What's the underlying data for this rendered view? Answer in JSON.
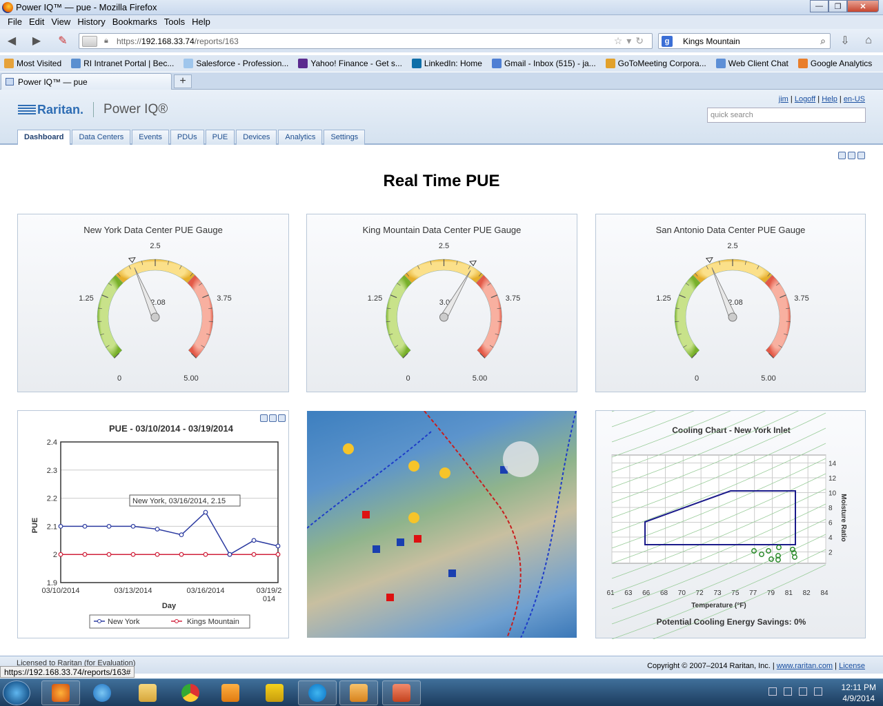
{
  "window": {
    "title": "Power IQ™ — pue - Mozilla Firefox"
  },
  "menu": [
    "File",
    "Edit",
    "View",
    "History",
    "Bookmarks",
    "Tools",
    "Help"
  ],
  "nav": {
    "url_prefix": "https://",
    "url_host": "192.168.33.74",
    "url_path": "/reports/163",
    "search_value": "Kings Mountain"
  },
  "bookmarks": [
    {
      "label": "Most Visited",
      "color": "#e6a23a"
    },
    {
      "label": "RI Intranet Portal | Bec...",
      "color": "#5a8fd0"
    },
    {
      "label": "Salesforce - Profession...",
      "color": "#9fc6ec"
    },
    {
      "label": "Yahoo! Finance - Get s...",
      "color": "#5b2b8f"
    },
    {
      "label": "LinkedIn: Home",
      "color": "#0e6ea8"
    },
    {
      "label": "Gmail - Inbox (515) - ja...",
      "color": "#4e7fd4"
    },
    {
      "label": "GoToMeeting Corpora...",
      "color": "#e2a12b"
    },
    {
      "label": "Web Client Chat",
      "color": "#5d8fd6"
    },
    {
      "label": "Google Analytics",
      "color": "#e97e2b"
    }
  ],
  "tab": {
    "label": "Power IQ™ — pue",
    "new": "+"
  },
  "app": {
    "brand": "Raritan.",
    "product": "Power IQ®",
    "user": "jim",
    "logoff": "Logoff",
    "help": "Help",
    "locale": "en-US",
    "quick_search_placeholder": "quick search",
    "tabs": [
      "Dashboard",
      "Data Centers",
      "Events",
      "PDUs",
      "PUE",
      "Devices",
      "Analytics",
      "Settings"
    ]
  },
  "page": {
    "title": "Real Time PUE"
  },
  "gauges": [
    {
      "title": "New York Data Center PUE Gauge",
      "value_label": "2.08",
      "value": 2.08,
      "min_label": "0",
      "max_label": "5.00",
      "t1": "1.25",
      "t2": "2.5",
      "t3": "3.75"
    },
    {
      "title": "King Mountain Data Center PUE Gauge",
      "value_label": "3.05",
      "value": 3.05,
      "min_label": "0",
      "max_label": "5.00",
      "t1": "1.25",
      "t2": "2.5",
      "t3": "3.75"
    },
    {
      "title": "San Antonio Data Center PUE Gauge",
      "value_label": "2.08",
      "value": 2.08,
      "min_label": "0",
      "max_label": "5.00",
      "t1": "1.25",
      "t2": "2.5",
      "t3": "3.75"
    }
  ],
  "chart_data": {
    "type": "line",
    "title": "PUE - 03/10/2014 - 03/19/2014",
    "xlabel": "Day",
    "ylabel": "PUE",
    "ylim": [
      1.9,
      2.4
    ],
    "yticks": [
      "1.9",
      "2",
      "2.1",
      "2.2",
      "2.3",
      "2.4"
    ],
    "xtick_labels": [
      "03/10/2014",
      "03/13/2014",
      "03/16/2014",
      "03/19/2",
      "014"
    ],
    "x": [
      0,
      1,
      2,
      3,
      4,
      5,
      6,
      7,
      8,
      9
    ],
    "series": [
      {
        "name": "New York",
        "values": [
          2.1,
          2.1,
          2.1,
          2.1,
          2.09,
          2.07,
          2.15,
          2.0,
          2.05,
          2.03
        ],
        "color": "#2b3aa0"
      },
      {
        "name": "Kings Mountain",
        "values": [
          2.0,
          2.0,
          2.0,
          2.0,
          2.0,
          2.0,
          2.0,
          2.0,
          2.0,
          2.0
        ],
        "color": "#d0203a"
      }
    ],
    "tooltip": "New York, 03/16/2014, 2.15"
  },
  "cooling": {
    "title": "Cooling Chart - New York Inlet",
    "xlabel": "Temperature (°F)",
    "ylabel": "Moisture Ratio",
    "xticks": [
      "61",
      "63",
      "66",
      "68",
      "70",
      "72",
      "73",
      "75",
      "77",
      "79",
      "81",
      "82",
      "84"
    ],
    "yticks": [
      "2",
      "4",
      "6",
      "8",
      "10",
      "12",
      "14"
    ],
    "savings": "Potential Cooling Energy Savings: 0%"
  },
  "footer": {
    "license": "Licensed to Raritan (for Evaluation)",
    "copyright": "Copyright © 2007–2014 Raritan, Inc.",
    "site": "www.raritan.com",
    "license_link": "License"
  },
  "status": {
    "url": "https://192.168.33.74/reports/163#"
  },
  "clock": {
    "time": "12:11 PM",
    "date": "4/9/2014"
  }
}
